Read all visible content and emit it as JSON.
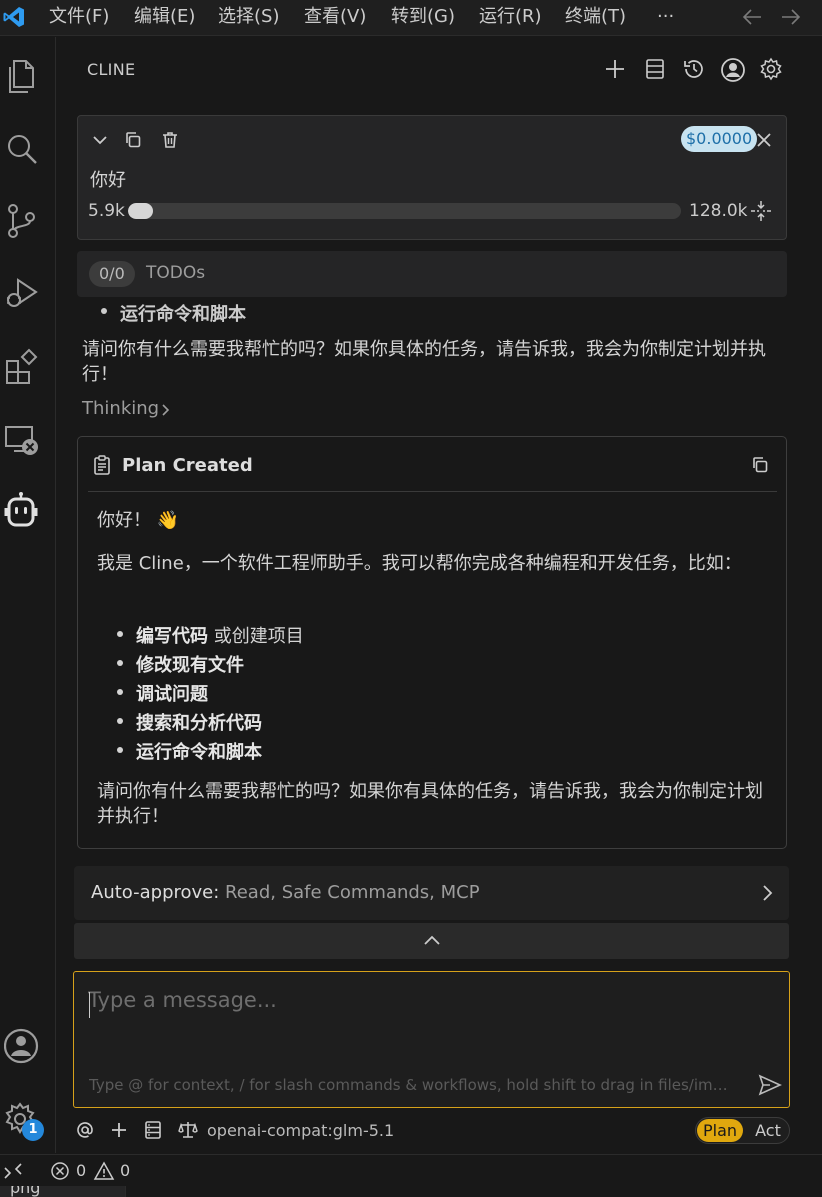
{
  "menu": {
    "items": [
      "文件(F)",
      "编辑(E)",
      "选择(S)",
      "查看(V)",
      "转到(G)",
      "运行(R)",
      "终端(T)",
      "···"
    ]
  },
  "panel": {
    "title": "CLINE"
  },
  "task": {
    "title": "你好",
    "cost": "$0.0000",
    "tokens_used": "5.9k",
    "tokens_max": "128.0k",
    "context_fraction": 0.046
  },
  "todos": {
    "count": "0/0",
    "label": "TODOs"
  },
  "chat": {
    "cut_bullet": "运行命令和脚本",
    "previous_message": "请问你有什么需要我帮忙的吗？如果你具体的任务，请告诉我，我会为你制定计划并执行！",
    "thinking_label": "Thinking"
  },
  "plan": {
    "title": "Plan Created",
    "greeting": "你好！ 👋",
    "intro": "我是 Cline，一个软件工程师助手。我可以帮你完成各种编程和开发任务，比如：",
    "items": [
      {
        "bold": "编写代码",
        "rest": " 或创建项目"
      },
      {
        "bold": "修改现有文件",
        "rest": ""
      },
      {
        "bold": "调试问题",
        "rest": ""
      },
      {
        "bold": "搜索和分析代码",
        "rest": ""
      },
      {
        "bold": "运行命令和脚本",
        "rest": ""
      }
    ],
    "closing": "请问你有什么需要我帮忙的吗？如果你有具体的任务，请告诉我，我会为你制定计划并执行！"
  },
  "auto_approve": {
    "label": "Auto-approve:",
    "value": " Read, Safe Commands, MCP"
  },
  "input": {
    "placeholder": "Type a message...",
    "hint": "Type @ for context, / for slash commands & workflows, hold shift to drag in files/ima..."
  },
  "toolbar": {
    "model": "openai-compat:glm-5.1",
    "mode_plan": "Plan",
    "mode_act": "Act"
  },
  "activity": {
    "badge": "1"
  },
  "status": {
    "errors": "0",
    "warnings": "0"
  },
  "bottom_tab": {
    "label": "png"
  },
  "colors": {
    "accent_plan": "#e0a80e",
    "input_border": "#d6a11a",
    "cost_badge": "#c8e3f0",
    "badge_blue": "#2488db"
  }
}
